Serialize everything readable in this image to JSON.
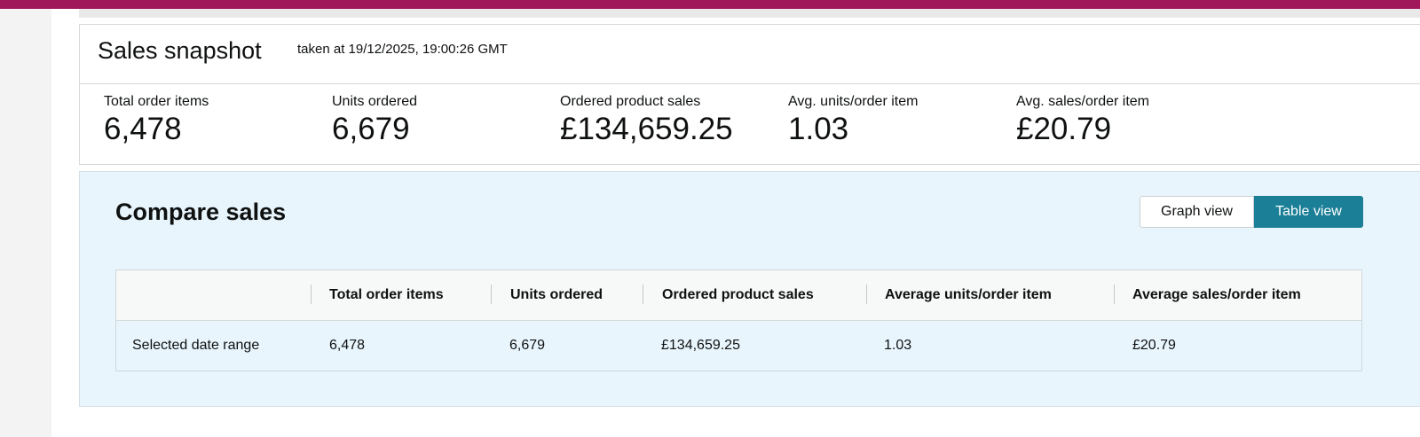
{
  "snapshot": {
    "title": "Sales snapshot",
    "subtitle": "taken at 19/12/2025, 19:00:26 GMT",
    "metrics": [
      {
        "label": "Total order items",
        "value": "6,478"
      },
      {
        "label": "Units ordered",
        "value": "6,679"
      },
      {
        "label": "Ordered product sales",
        "value": "£134,659.25"
      },
      {
        "label": "Avg. units/order item",
        "value": "1.03"
      },
      {
        "label": "Avg. sales/order item",
        "value": "£20.79"
      }
    ]
  },
  "compare": {
    "title": "Compare sales",
    "toggle": {
      "graph_label": "Graph view",
      "table_label": "Table view",
      "active": "table"
    },
    "table": {
      "columns": [
        "",
        "Total order items",
        "Units ordered",
        "Ordered product sales",
        "Average units/order item",
        "Average sales/order item"
      ],
      "rows": [
        [
          "Selected date range",
          "6,478",
          "6,679",
          "£134,659.25",
          "1.03",
          "£20.79"
        ]
      ]
    }
  },
  "colors": {
    "topbar": "#a0175a",
    "accent": "#1b7f97",
    "compare_bg": "#e8f5fd"
  }
}
